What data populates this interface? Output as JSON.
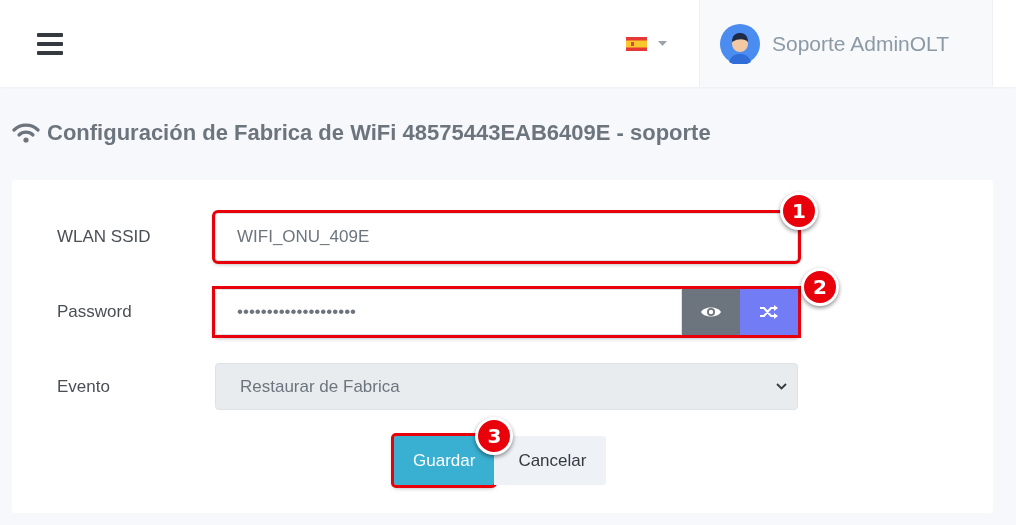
{
  "header": {
    "user": {
      "name": "Soporte AdminOLT"
    }
  },
  "page_title": "Configuración de Fabrica de WiFi 48575443EAB6409E - soporte",
  "fields": [
    {
      "kind": "text",
      "label": "WLAN SSID",
      "value": "WIFI_ONU_409E",
      "highlighted": true,
      "callout": "1"
    },
    {
      "kind": "password",
      "label": "Password",
      "value": "••••••••••••••••••••",
      "highlighted": true,
      "callout": "2"
    },
    {
      "kind": "select",
      "label": "Evento",
      "value": "Restaurar de Fabrica",
      "disabled": true
    }
  ],
  "buttons": [
    {
      "kind": "primary",
      "label": "Guardar",
      "highlighted": true,
      "callout": "3"
    },
    {
      "kind": "secondary",
      "label": "Cancelar",
      "highlighted": false
    }
  ]
}
